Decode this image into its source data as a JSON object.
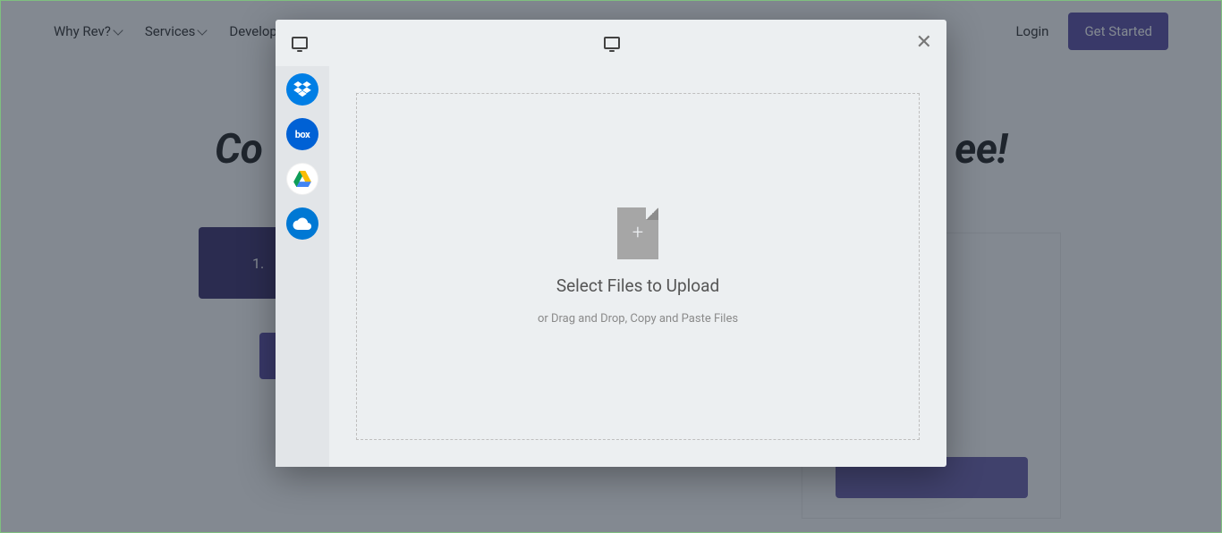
{
  "nav": {
    "items": [
      "Why Rev?",
      "Services",
      "Developers"
    ],
    "login": "Login",
    "cta": "Get Started"
  },
  "hero": {
    "title_prefix": "Co",
    "title_suffix": "ee!",
    "bar_prefix": "1."
  },
  "modal": {
    "sources": {
      "dropbox": "Dropbox",
      "box": "box",
      "gdrive": "Google Drive",
      "onedrive": "OneDrive"
    },
    "dropzone": {
      "title": "Select Files to Upload",
      "subtitle": "or Drag and Drop, Copy and Paste Files"
    }
  }
}
